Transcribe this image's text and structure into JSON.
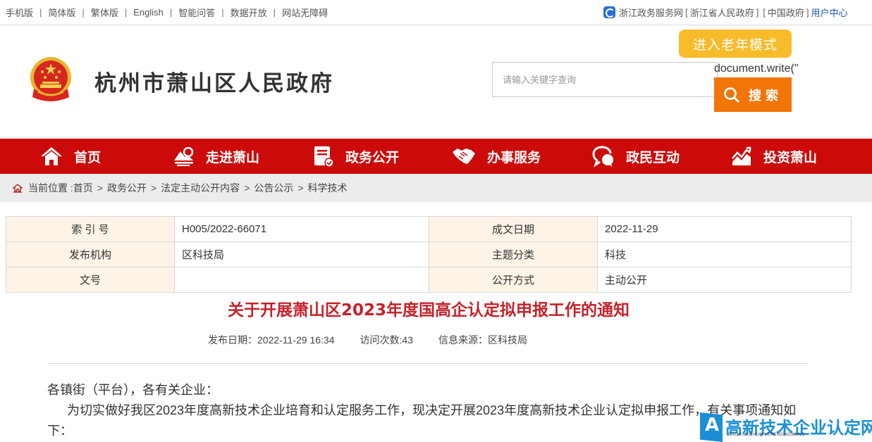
{
  "topbar": {
    "left_links": [
      "手机版",
      "简体版",
      "繁体版",
      "English",
      "智能问答",
      "数据开放",
      "网站无障碍"
    ],
    "separator": "|",
    "right": {
      "zj_link": "浙江政务服务网",
      "prov_link": "浙江省人民政府",
      "china_link": "中国政府",
      "user_center": "用户中心",
      "bracket_open": "[",
      "bracket_close": "]"
    }
  },
  "header": {
    "site_title": "杭州市萧山区人民政府",
    "elder_mode_label": "进入老年模式",
    "search_placeholder": "请输入关键字查询",
    "search_value": "",
    "doc_write_text": "document.write(\"",
    "search_button_label": "搜索"
  },
  "nav": {
    "items": [
      {
        "label": "首页",
        "icon": "home-icon"
      },
      {
        "label": "走进萧山",
        "icon": "landscape-icon"
      },
      {
        "label": "政务公开",
        "icon": "document-check-icon"
      },
      {
        "label": "办事服务",
        "icon": "handshake-icon"
      },
      {
        "label": "政民互动",
        "icon": "chat-bubbles-icon"
      },
      {
        "label": "投资萧山",
        "icon": "trend-chart-icon"
      }
    ]
  },
  "breadcrumb": {
    "prefix": "当前位置 :",
    "items": [
      "首页",
      "政务公开",
      "法定主动公开内容",
      "公告公示",
      "科学技术"
    ],
    "separator": ">"
  },
  "info_table": {
    "rows": [
      {
        "k1": "索 引 号",
        "v1": "H005/2022-66071",
        "k2": "成文日期",
        "v2": "2022-11-29"
      },
      {
        "k1": "发布机构",
        "v1": "区科技局",
        "k2": "主题分类",
        "v2": "科技"
      },
      {
        "k1": "文号",
        "v1": "",
        "k2": "公开方式",
        "v2": "主动公开"
      }
    ]
  },
  "article": {
    "title": "关于开展萧山区2023年度国高企认定拟申报工作的通知",
    "meta": {
      "publish_date": "发布日期：2022-11-29 16:34",
      "visits": "访问次数:43",
      "source": "信息来源：区科技局"
    },
    "salutation": "各镇街（平台），各有关企业：",
    "paragraph1": "为切实做好我区2023年度高新技术企业培育和认定服务工作，现决定开展2023年度高新技术企业认定拟申报工作，有关事项通知如下："
  },
  "watermark": {
    "logo_letter": "A",
    "text": "高新技术企业认定网",
    "subtext": "GAOXINJISHUQIYERENDINGWANG"
  },
  "colors": {
    "nav_red": "#cc0a0a",
    "title_red": "#c5222a",
    "search_orange": "#f27507",
    "elder_yellow": "#f8bb2a",
    "table_key_bg": "#fdf3e7",
    "watermark_blue": "#1b8fd6"
  }
}
